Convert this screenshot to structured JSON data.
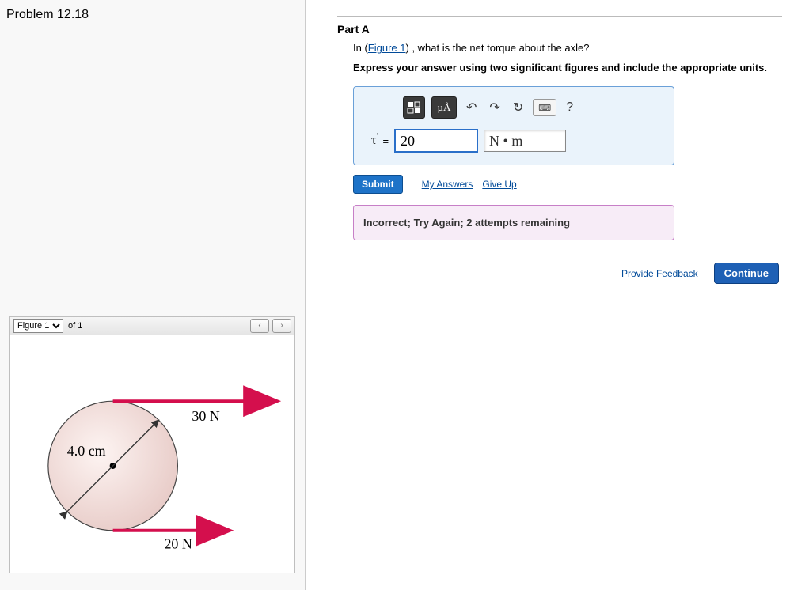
{
  "problem": {
    "title": "Problem 12.18"
  },
  "figure": {
    "select_label": "Figure 1",
    "of_label": "of 1",
    "prev": "‹",
    "next": "›",
    "top_force": "30 N",
    "bottom_force": "20 N",
    "radius_label": "4.0 cm"
  },
  "partA": {
    "label": "Part A",
    "question_pre": "In (",
    "figure_link": "Figure 1",
    "question_post": ") , what is the net torque about the axle?",
    "instruction": "Express your answer using two significant figures and include the appropriate units.",
    "toolbar": {
      "templates": "▭",
      "units_btn": "µÅ",
      "undo": "↶",
      "redo": "↷",
      "reset": "↻",
      "keyboard": "⌨",
      "help": "?"
    },
    "var_symbol": "τ",
    "equals": " = ",
    "value": "20",
    "units": "N • m",
    "submit": "Submit",
    "my_answers": "My Answers",
    "give_up": "Give Up",
    "feedback": "Incorrect; Try Again; 2 attempts remaining"
  },
  "footer": {
    "provide_feedback": "Provide Feedback",
    "continue": "Continue"
  }
}
